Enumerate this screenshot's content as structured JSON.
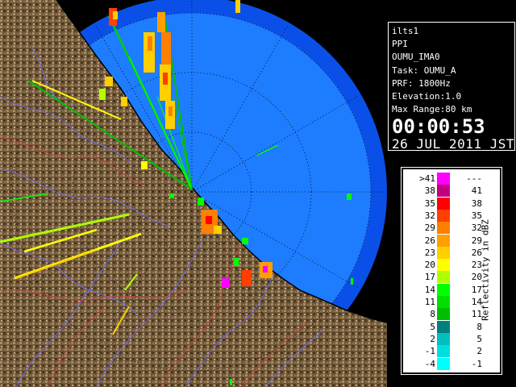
{
  "info": {
    "radar": "ilts1",
    "mode": "PPI",
    "site": "OUMU_IMA0",
    "task": "Task: OUMU_A",
    "prf": "PRF: 1800Hz",
    "elevation": "Elevation:1.0",
    "max_range": "Max Range:80 km",
    "time": "00:00:53",
    "date": "26 JUL 2011 JST"
  },
  "legend": {
    "title": "Reflectivity in dBZ",
    "rows": [
      {
        "lo": ">41",
        "hi": "---",
        "color": "#ff00ff"
      },
      {
        "lo": "38",
        "hi": "41",
        "color": "#c0007f"
      },
      {
        "lo": "35",
        "hi": "38",
        "color": "#ff0000"
      },
      {
        "lo": "32",
        "hi": "35",
        "color": "#ff3f00"
      },
      {
        "lo": "29",
        "hi": "32",
        "color": "#ff7f00"
      },
      {
        "lo": "26",
        "hi": "29",
        "color": "#ff9f00"
      },
      {
        "lo": "23",
        "hi": "26",
        "color": "#ffcf00"
      },
      {
        "lo": "20",
        "hi": "23",
        "color": "#ffff00"
      },
      {
        "lo": "17",
        "hi": "20",
        "color": "#afff00"
      },
      {
        "lo": "14",
        "hi": "17",
        "color": "#00ff00"
      },
      {
        "lo": "11",
        "hi": "14",
        "color": "#00df00"
      },
      {
        "lo": "8",
        "hi": "11",
        "color": "#00bf00"
      },
      {
        "lo": "5",
        "hi": "8",
        "color": "#007f7f"
      },
      {
        "lo": "2",
        "hi": "5",
        "color": "#00bfbf"
      },
      {
        "lo": "-1",
        "hi": "2",
        "color": "#00dfdf"
      },
      {
        "lo": "-4",
        "hi": "-1",
        "color": "#00ffff"
      }
    ]
  },
  "map": {
    "range_ring_color": "#0050ff",
    "sea_color": "#1e7cff",
    "land_color": "#7a6040"
  }
}
